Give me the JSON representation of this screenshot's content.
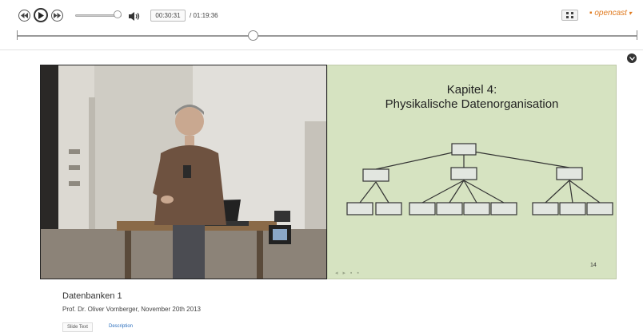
{
  "player": {
    "time_current": "00:30:31",
    "time_total": "/ 01:19:36",
    "volume_fraction": 0.92,
    "seek_fraction": 0.38,
    "brand": "opencast",
    "colors": {
      "brand": "#e07a1f",
      "link": "#2a6ebd",
      "slide_bg": "#d6e3c1"
    }
  },
  "slide": {
    "title_line1": "Kapitel 4:",
    "title_line2": "Physikalische Datenorganisation",
    "page": "14"
  },
  "lecture": {
    "title": "Datenbanken 1",
    "subtitle": "Prof. Dr. Oliver Vornberger,  November 20th 2013"
  },
  "tabs": {
    "slide_text": "Slide Text",
    "description": "Description"
  }
}
